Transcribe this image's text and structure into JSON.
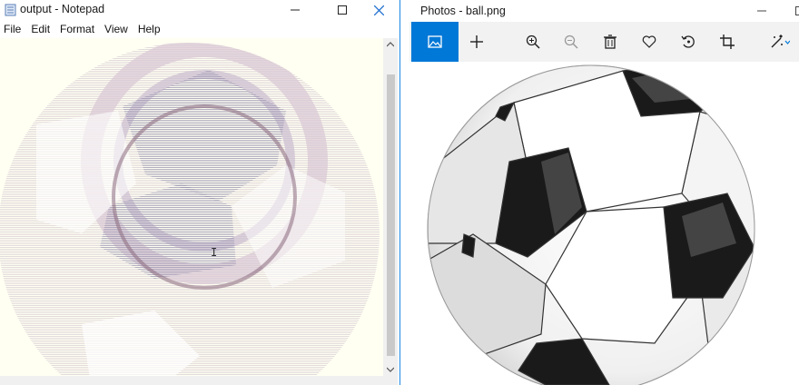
{
  "notepad": {
    "title": "output - Notepad",
    "menu": [
      "File",
      "Edit",
      "Format",
      "View",
      "Help"
    ]
  },
  "photos": {
    "title": "Photos - ball.png",
    "toolbar_icons": [
      "image-view-icon",
      "add-icon",
      "zoom-in-icon",
      "zoom-out-icon",
      "delete-icon",
      "favorite-icon",
      "rotate-icon",
      "crop-icon",
      "edit-icon"
    ]
  },
  "colors": {
    "accent": "#0078d7",
    "notepad_bg": "#fffff2",
    "ball_black": "#1a1a1a",
    "ball_white": "#ffffff"
  }
}
